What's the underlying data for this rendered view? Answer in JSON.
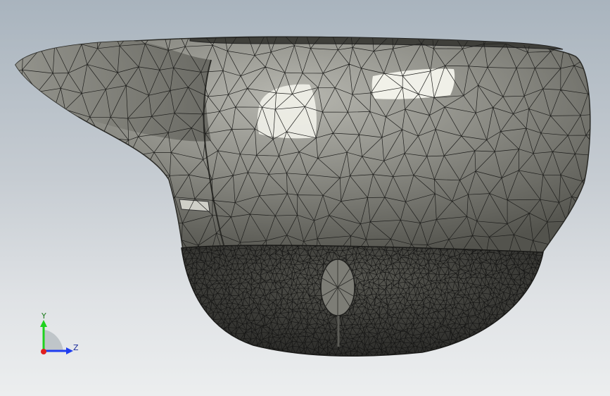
{
  "viewport": {
    "background_top": "#a9b4be",
    "background_bottom": "#eceeef"
  },
  "model": {
    "body_color": "#8f8f88",
    "body_dark": "#4e4e48",
    "highlight_color": "#f4f4ec",
    "mesh_edge_color": "#1e1e1c",
    "visor_color": "#2a2a28"
  },
  "triad": {
    "y_label": "Y",
    "z_label": "Z",
    "y_color": "#1fd21f",
    "z_color": "#1f3df0",
    "x_color": "#e02020"
  }
}
